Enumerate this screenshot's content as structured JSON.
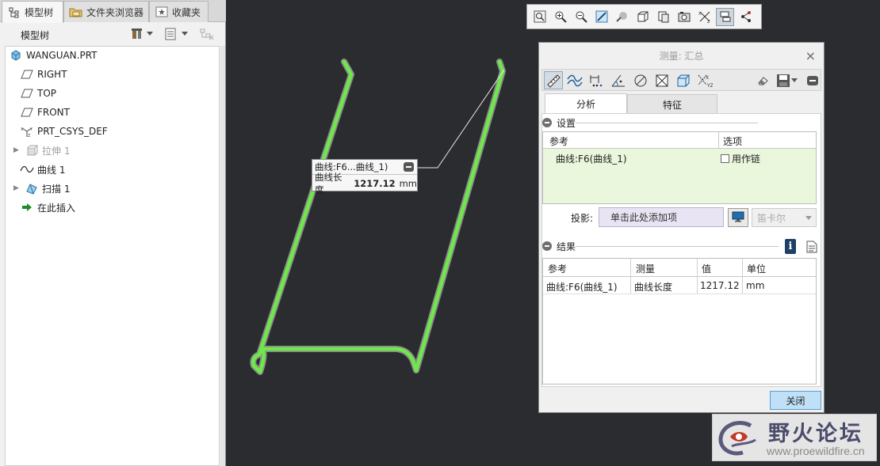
{
  "colors": {
    "graphics_bg": "#2b2c30",
    "curve_green": "#6ee84a",
    "settings_row_bg": "#eaf7dc",
    "close_button_bg": "#bfe0f6"
  },
  "left_tabs": [
    {
      "label": "模型树",
      "icon": "tree-icon"
    },
    {
      "label": "文件夹浏览器",
      "icon": "folder-icon"
    },
    {
      "label": "收藏夹",
      "icon": "star-icon"
    }
  ],
  "tree": {
    "title": "模型树",
    "items": [
      {
        "label": "WANGUAN.PRT",
        "icon": "part-icon"
      },
      {
        "label": "RIGHT",
        "icon": "datum-plane-icon"
      },
      {
        "label": "TOP",
        "icon": "datum-plane-icon"
      },
      {
        "label": "FRONT",
        "icon": "datum-plane-icon"
      },
      {
        "label": "PRT_CSYS_DEF",
        "icon": "csys-icon"
      },
      {
        "label": "拉伸 1",
        "icon": "extrude-icon"
      },
      {
        "label": "曲线 1",
        "icon": "curve-icon"
      },
      {
        "label": "扫描 1",
        "icon": "sweep-icon"
      },
      {
        "label": "在此插入",
        "icon": "insert-arrow-icon"
      }
    ]
  },
  "callout": {
    "title": "曲线:F6...曲线_1)",
    "label": "曲线长度",
    "value": "1217.12",
    "unit": "mm"
  },
  "dialog": {
    "title": "测量: 汇总",
    "tabs": [
      "分析",
      "特征"
    ],
    "settings": {
      "header": "设置",
      "col_ref": "参考",
      "col_opt": "选项",
      "row_ref": "曲线:F6(曲线_1)",
      "row_opt": "用作链"
    },
    "projection": {
      "label": "投影:",
      "placeholder": "单击此处添加项",
      "coord_system": "笛卡尔"
    },
    "results": {
      "header": "结果",
      "columns": [
        "参考",
        "测量",
        "值",
        "单位"
      ],
      "rows": [
        {
          "ref": "曲线:F6(曲线_1)",
          "measure": "曲线长度",
          "value": "1217.12",
          "unit": "mm"
        }
      ]
    },
    "close_label": "关闭"
  },
  "watermark": {
    "title": "野火论坛",
    "url": "www.proewildfire.cn"
  }
}
